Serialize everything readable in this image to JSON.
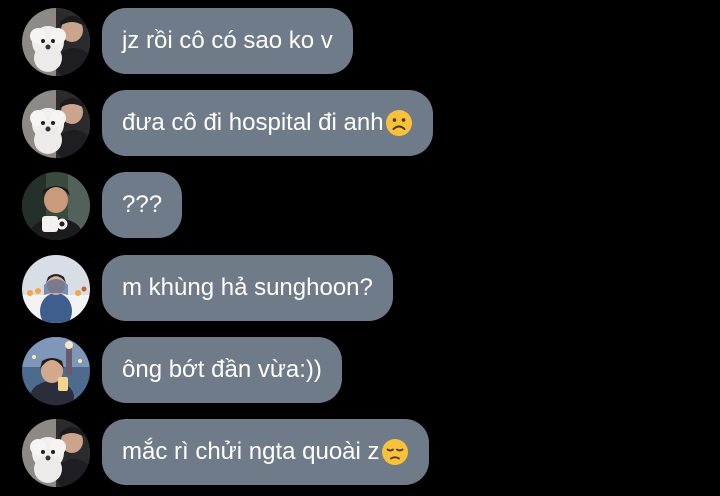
{
  "conversation": {
    "messages": [
      {
        "avatar": "avatar-dog-selfie",
        "text": "jz rồi cô có sao ko v",
        "emoji": ""
      },
      {
        "avatar": "avatar-dog-selfie",
        "text": "đưa cô đi hospital đi anh",
        "emoji": "frowning-face-icon"
      },
      {
        "avatar": "avatar-boy-mug",
        "text": "???",
        "emoji": ""
      },
      {
        "avatar": "avatar-boy-snow",
        "text": "m khùng hả sunghoon?",
        "emoji": ""
      },
      {
        "avatar": "avatar-boy-city",
        "text": "ông bớt đần vừa:))",
        "emoji": ""
      },
      {
        "avatar": "avatar-dog-selfie",
        "text": "mắc rì chửi ngta quoài z",
        "emoji": "pensive-face-icon"
      }
    ]
  },
  "colors": {
    "background": "#000000",
    "bubble": "#6f7b88",
    "text": "#ffffff"
  }
}
